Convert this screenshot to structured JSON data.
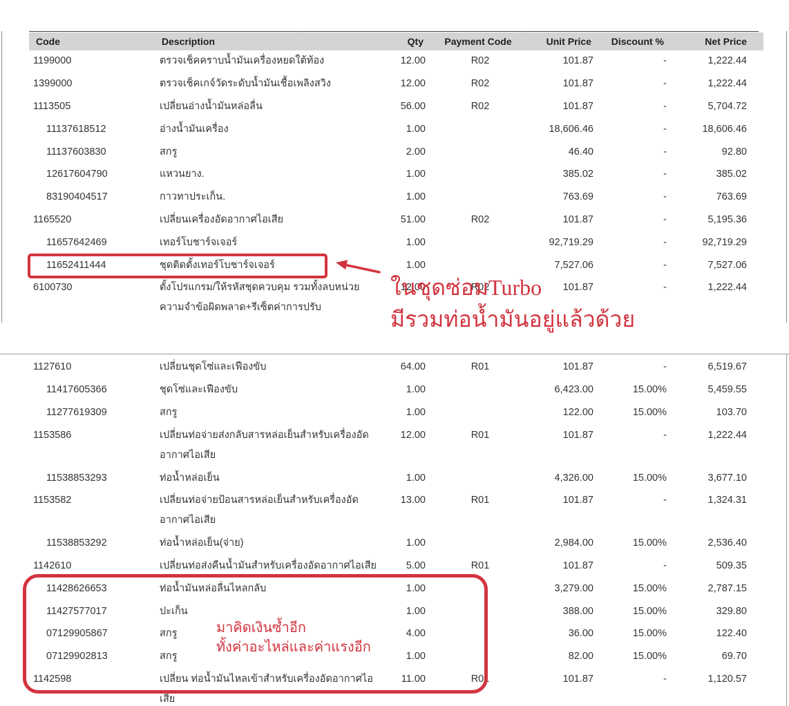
{
  "colors": {
    "annotation": "#d2343f",
    "header_bg": "#d4d4d4"
  },
  "table": {
    "columns": {
      "code": "Code",
      "description": "Description",
      "qty": "Qty",
      "payment_code": "Payment Code",
      "unit_price": "Unit Price",
      "discount": "Discount %",
      "net_price": "Net Price"
    },
    "sections": [
      {
        "rows": [
          {
            "item_type": "labor",
            "code": "1199000",
            "description": [
              "ตรวจเช็คคราบน้ำมันเครื่องหยดใต้ท้อง"
            ],
            "qty": "12.00",
            "payment_code": "R02",
            "unit_price": "101.87",
            "discount": "-",
            "net_price": "1,222.44"
          },
          {
            "item_type": "labor",
            "code": "1399000",
            "description": [
              "ตรวจเช็คเกจ์วัดระดับน้ำมันเชื้อเพลิงสวิง"
            ],
            "qty": "12.00",
            "payment_code": "R02",
            "unit_price": "101.87",
            "discount": "-",
            "net_price": "1,222.44"
          },
          {
            "item_type": "labor",
            "code": "1113505",
            "description": [
              "เปลี่ยนอ่างน้ำมันหล่อลื่น"
            ],
            "qty": "56.00",
            "payment_code": "R02",
            "unit_price": "101.87",
            "discount": "-",
            "net_price": "5,704.72"
          },
          {
            "item_type": "part",
            "code": "11137618512",
            "description": [
              "อ่างน้ำมันเครื่อง"
            ],
            "qty": "1.00",
            "payment_code": "",
            "unit_price": "18,606.46",
            "discount": "-",
            "net_price": "18,606.46"
          },
          {
            "item_type": "part",
            "code": "11137603830",
            "description": [
              "สกรู"
            ],
            "qty": "2.00",
            "payment_code": "",
            "unit_price": "46.40",
            "discount": "-",
            "net_price": "92.80"
          },
          {
            "item_type": "part",
            "code": "12617604790",
            "description": [
              "แหวนยาง."
            ],
            "qty": "1.00",
            "payment_code": "",
            "unit_price": "385.02",
            "discount": "-",
            "net_price": "385.02"
          },
          {
            "item_type": "part",
            "code": "83190404517",
            "description": [
              "กาวทาประเก็น."
            ],
            "qty": "1.00",
            "payment_code": "",
            "unit_price": "763.69",
            "discount": "-",
            "net_price": "763.69"
          },
          {
            "item_type": "labor",
            "code": "1165520",
            "description": [
              "เปลี่ยนเครื่องอัดอากาศไอเสีย"
            ],
            "qty": "51.00",
            "payment_code": "R02",
            "unit_price": "101.87",
            "discount": "-",
            "net_price": "5,195.36"
          },
          {
            "item_type": "part",
            "code": "11657642469",
            "description": [
              "เทอร์โบชาร์จเจอร์"
            ],
            "qty": "1.00",
            "payment_code": "",
            "unit_price": "92,719.29",
            "discount": "-",
            "net_price": "92,719.29"
          },
          {
            "item_type": "part",
            "code": "11652411444",
            "description": [
              "ชุดติดตั้งเทอร์โบชาร์จเจอร์"
            ],
            "qty": "1.00",
            "payment_code": "",
            "unit_price": "7,527.06",
            "discount": "-",
            "net_price": "7,527.06"
          },
          {
            "item_type": "labor",
            "code": "6100730",
            "description": [
              "ตั้งโปรแกรม/ให้รหัสชุดควบคุม รวมทั้งลบหน่วย",
              "ความจำข้อผิดพลาด+รีเซ็ตค่าการปรับ"
            ],
            "qty": "12.00",
            "payment_code": "R02",
            "unit_price": "101.87",
            "discount": "-",
            "net_price": "1,222.44"
          }
        ]
      },
      {
        "rows": [
          {
            "item_type": "labor",
            "code": "1127610",
            "description": [
              "เปลี่ยนชุดโซ่และเฟืองขับ"
            ],
            "qty": "64.00",
            "payment_code": "R01",
            "unit_price": "101.87",
            "discount": "-",
            "net_price": "6,519.67"
          },
          {
            "item_type": "part",
            "code": "11417605366",
            "description": [
              "ชุดโซ่และเฟืองขับ"
            ],
            "qty": "1.00",
            "payment_code": "",
            "unit_price": "6,423.00",
            "discount": "15.00%",
            "net_price": "5,459.55"
          },
          {
            "item_type": "part",
            "code": "11277619309",
            "description": [
              "สกรู"
            ],
            "qty": "1.00",
            "payment_code": "",
            "unit_price": "122.00",
            "discount": "15.00%",
            "net_price": "103.70"
          },
          {
            "item_type": "labor",
            "code": "1153586",
            "description": [
              "เปลี่ยนท่อจ่ายส่งกลับสารหล่อเย็นสำหรับเครื่องอัด",
              "อากาศไอเสีย"
            ],
            "qty": "12.00",
            "payment_code": "R01",
            "unit_price": "101.87",
            "discount": "-",
            "net_price": "1,222.44"
          },
          {
            "item_type": "part",
            "code": "11538853293",
            "description": [
              "ท่อน้ำหล่อเย็น"
            ],
            "qty": "1.00",
            "payment_code": "",
            "unit_price": "4,326.00",
            "discount": "15.00%",
            "net_price": "3,677.10"
          },
          {
            "item_type": "labor",
            "code": "1153582",
            "description": [
              "เปลี่ยนท่อจ่ายป้อนสารหล่อเย็นสำหรับเครื่องอัด",
              "อากาศไอเสีย"
            ],
            "qty": "13.00",
            "payment_code": "R01",
            "unit_price": "101.87",
            "discount": "-",
            "net_price": "1,324.31"
          },
          {
            "item_type": "part",
            "code": "11538853292",
            "description": [
              "ท่อน้ำหล่อเย็น(จ่าย)"
            ],
            "qty": "1.00",
            "payment_code": "",
            "unit_price": "2,984.00",
            "discount": "15.00%",
            "net_price": "2,536.40"
          },
          {
            "item_type": "labor",
            "code": "1142610",
            "description": [
              "เปลี่ยนท่อส่งคืนน้ำมันสำหรับเครื่องอัดอากาศไอเสีย"
            ],
            "qty": "5.00",
            "payment_code": "R01",
            "unit_price": "101.87",
            "discount": "-",
            "net_price": "509.35"
          },
          {
            "item_type": "part",
            "code": "11428626653",
            "description": [
              "ท่อน้ำมันหล่อลื่นไหลกลับ"
            ],
            "qty": "1.00",
            "payment_code": "",
            "unit_price": "3,279.00",
            "discount": "15.00%",
            "net_price": "2,787.15"
          },
          {
            "item_type": "part",
            "code": "11427577017",
            "description": [
              "ปะเก็น"
            ],
            "qty": "1.00",
            "payment_code": "",
            "unit_price": "388.00",
            "discount": "15.00%",
            "net_price": "329.80"
          },
          {
            "item_type": "part",
            "code": "07129905867",
            "description": [
              "สกรู"
            ],
            "qty": "4.00",
            "payment_code": "",
            "unit_price": "36.00",
            "discount": "15.00%",
            "net_price": "122.40"
          },
          {
            "item_type": "part",
            "code": "07129902813",
            "description": [
              "สกรู"
            ],
            "qty": "1.00",
            "payment_code": "",
            "unit_price": "82.00",
            "discount": "15.00%",
            "net_price": "69.70"
          },
          {
            "item_type": "labor",
            "code": "1142598",
            "description": [
              "เปลี่ยน ท่อน้ำมันไหลเข้าสำหรับเครื่องอัดอากาศไอ",
              "เสีย"
            ],
            "qty": "11.00",
            "payment_code": "R01",
            "unit_price": "101.87",
            "discount": "-",
            "net_price": "1,120.57"
          }
        ]
      }
    ]
  },
  "annotations": {
    "turbo_note": {
      "lines": [
        "ในชุดซ่อมTurbo",
        "มีรวมท่อน้ำมันอยู่แล้วด้วย"
      ]
    },
    "duplicate_note": {
      "lines": [
        "มาคิดเงินซ้ำอีก",
        "ทั้งค่าอะไหล่และค่าแรงอีก"
      ]
    }
  }
}
